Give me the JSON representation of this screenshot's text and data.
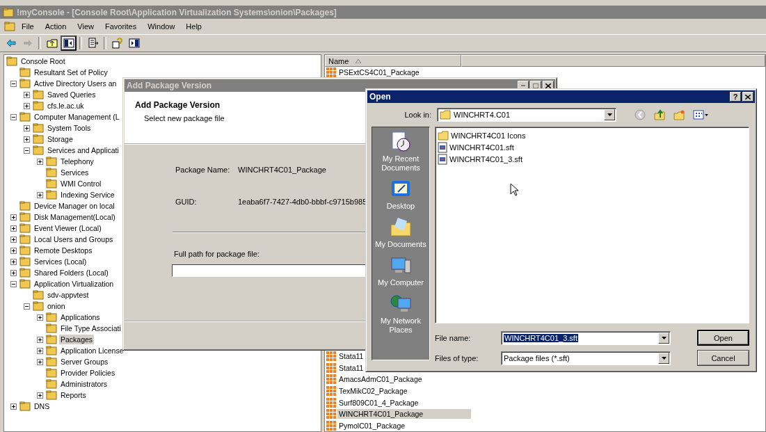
{
  "main_window": {
    "title": "!myConsole - [Console Root\\Application Virtualization Systems\\onion\\Packages]",
    "menu": [
      "File",
      "Action",
      "View",
      "Favorites",
      "Window",
      "Help"
    ],
    "toolbar": [
      {
        "pressed": false,
        "disabled": false
      },
      {
        "pressed": false,
        "disabled": true
      },
      {
        "pressed": false,
        "disabled": false
      },
      {
        "pressed": true,
        "disabled": false
      },
      {
        "pressed": false,
        "disabled": false
      },
      {
        "pressed": false,
        "disabled": false
      },
      {
        "pressed": false,
        "disabled": false
      }
    ]
  },
  "tree": {
    "label": "Console Root",
    "selected": false,
    "children": [
      {
        "label": "Resultant Set of Policy",
        "selected": false
      },
      {
        "label": "Active Directory Users an",
        "selected": false,
        "expanded": true,
        "children": [
          {
            "label": "Saved Queries",
            "selected": false,
            "expanded": false
          },
          {
            "label": "cfs.le.ac.uk",
            "selected": false,
            "expanded": false
          }
        ]
      },
      {
        "label": "Computer Management (L",
        "selected": false,
        "expanded": true,
        "children": [
          {
            "label": "System Tools",
            "selected": false,
            "expanded": false
          },
          {
            "label": "Storage",
            "selected": false,
            "expanded": false
          },
          {
            "label": "Services and Applicati",
            "selected": false,
            "expanded": true,
            "children": [
              {
                "label": "Telephony",
                "selected": false,
                "expanded": false
              },
              {
                "label": "Services",
                "selected": false
              },
              {
                "label": "WMI Control",
                "selected": false
              },
              {
                "label": "Indexing Service",
                "selected": false,
                "expanded": false
              }
            ]
          }
        ]
      },
      {
        "label": "Device Manager on local",
        "selected": false
      },
      {
        "label": "Disk Management(Local)",
        "selected": false,
        "expanded": false
      },
      {
        "label": "Event Viewer (Local)",
        "selected": false,
        "expanded": false
      },
      {
        "label": "Local Users and Groups",
        "selected": false,
        "expanded": false
      },
      {
        "label": "Remote Desktops",
        "selected": false,
        "expanded": false
      },
      {
        "label": "Services (Local)",
        "selected": false,
        "expanded": false
      },
      {
        "label": "Shared Folders (Local)",
        "selected": false,
        "expanded": false
      },
      {
        "label": "Application Virtualization",
        "selected": false,
        "expanded": true,
        "children": [
          {
            "label": "sdv-appvtest",
            "selected": false
          },
          {
            "label": "onion",
            "selected": false,
            "expanded": true,
            "children": [
              {
                "label": "Applications",
                "selected": false,
                "expanded": false
              },
              {
                "label": "File Type Associati",
                "selected": false
              },
              {
                "label": "Packages",
                "selected": true,
                "expanded": false
              },
              {
                "label": "Application License",
                "selected": false,
                "expanded": false
              },
              {
                "label": "Server Groups",
                "selected": false,
                "expanded": false
              },
              {
                "label": "Provider Policies",
                "selected": false
              },
              {
                "label": "Administrators",
                "selected": false
              },
              {
                "label": "Reports",
                "selected": false,
                "expanded": false
              }
            ]
          }
        ]
      },
      {
        "label": "DNS",
        "selected": false,
        "expanded": false
      }
    ]
  },
  "list": {
    "columns": [
      "Name"
    ],
    "row_groups": [
      [
        {
          "name": "PSExtCS4C01_Package",
          "selected": false
        }
      ],
      [
        {
          "name": "Stata11",
          "selected": false
        },
        {
          "name": "Stata11",
          "selected": false
        },
        {
          "name": "AmacsAdmC01_Package",
          "selected": false
        },
        {
          "name": "TexMikC02_Package",
          "selected": false
        },
        {
          "name": "Surf809C01_4_Package",
          "selected": false
        },
        {
          "name": "WINCHRT4C01_Package",
          "selected": true
        },
        {
          "name": "PymolC01_Package",
          "selected": false
        }
      ]
    ]
  },
  "add_dialog": {
    "title": "Add Package Version",
    "heading": "Add Package Version",
    "subheading": "Select new package file",
    "fields": [
      {
        "label": "Package Name:",
        "value": "WINCHRT4C01_Package"
      },
      {
        "label": "GUID:",
        "value": "1eaba6f7-7427-4db0-bbbf-c9715b985"
      }
    ],
    "path_label": "Full path for package file:"
  },
  "open_dialog": {
    "title": "Open",
    "help": "?",
    "look_in": {
      "label": "Look in:",
      "value": "WINCHRT4.C01"
    },
    "places": [
      "My Recent Documents",
      "Desktop",
      "My Documents",
      "My Computer",
      "My Network Places"
    ],
    "files": [
      {
        "name": "WINCHRT4C01 Icons",
        "kind": "folder",
        "selected": false
      },
      {
        "name": "WINCHRT4C01.sft",
        "kind": "file",
        "selected": false
      },
      {
        "name": "WINCHRT4C01_3.sft",
        "kind": "file",
        "selected": false
      }
    ],
    "file_name": {
      "label": "File name:",
      "value": "WINCHRT4C01_3.sft",
      "highlighted": true
    },
    "file_type": {
      "label": "Files of type:",
      "value": "Package files (*.sft)"
    },
    "buttons": [
      {
        "label": "Open",
        "default": true
      },
      {
        "label": "Cancel",
        "default": false
      }
    ]
  }
}
